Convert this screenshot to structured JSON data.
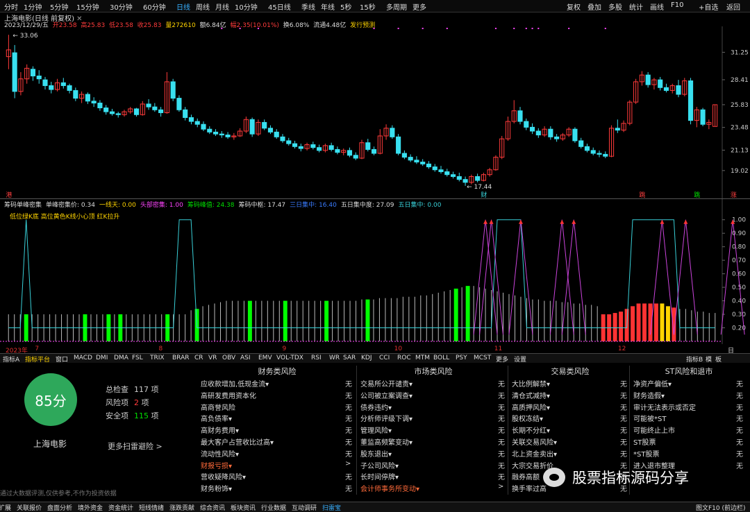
{
  "timeframes": [
    "分时",
    "1分钟",
    "5分钟",
    "15分钟",
    "30分钟",
    "60分钟",
    "日线",
    "周线",
    "月线",
    "10分钟",
    "45日线",
    "季线",
    "年线",
    "5秒",
    "15秒",
    "多周期",
    "更多"
  ],
  "active_timeframe": "日线",
  "toolbar_right": [
    "复权",
    "叠加",
    "多股",
    "统计",
    "画线",
    "F10",
    "+自选",
    "返回"
  ],
  "chart_title": "上海电影(日线 前复权)",
  "ohlc": {
    "date": "2023/12/29/五",
    "open": "开23.58",
    "high": "高25.83",
    "low": "低23.58",
    "close": "收25.83",
    "vol": "量272610",
    "amount": "额6.84亿",
    "pct": "幅2.35(10.01%)",
    "turnover": "换6.08%",
    "float": "流通4.48亿",
    "brand": "发行预测"
  },
  "price_max_label": "33.06",
  "price_min_label": "17.44",
  "price_axis": [
    "31.25",
    "28.41",
    "25.83",
    "23.48",
    "21.13",
    "19.02"
  ],
  "price_axis_range": [
    17,
    33.5
  ],
  "candles": [
    [
      30.8,
      33.06,
      29.5,
      31.5
    ],
    [
      31.2,
      32.0,
      26.5,
      27.2
    ],
    [
      27.2,
      29.2,
      26.8,
      28.5
    ],
    [
      28.5,
      30.0,
      28.0,
      29.6
    ],
    [
      29.5,
      29.8,
      28.3,
      28.8
    ],
    [
      28.8,
      29.4,
      28.0,
      28.5
    ],
    [
      28.4,
      28.7,
      27.4,
      27.8
    ],
    [
      27.8,
      28.2,
      27.0,
      27.4
    ],
    [
      27.4,
      28.5,
      27.2,
      28.1
    ],
    [
      28.1,
      28.6,
      27.5,
      27.8
    ],
    [
      27.8,
      28.0,
      27.0,
      27.3
    ],
    [
      27.3,
      27.6,
      26.2,
      26.5
    ],
    [
      26.5,
      27.2,
      26.0,
      26.9
    ],
    [
      26.9,
      27.1,
      25.9,
      26.2
    ],
    [
      26.2,
      26.6,
      25.6,
      26.0
    ],
    [
      26.0,
      26.3,
      25.2,
      25.5
    ],
    [
      25.5,
      25.8,
      24.8,
      25.1
    ],
    [
      25.1,
      25.4,
      24.7,
      24.9
    ],
    [
      24.9,
      25.1,
      24.5,
      24.8
    ],
    [
      24.8,
      25.3,
      24.6,
      25.1
    ],
    [
      25.1,
      25.6,
      24.9,
      25.4
    ],
    [
      25.4,
      25.5,
      24.6,
      24.8
    ],
    [
      24.8,
      26.2,
      24.7,
      25.9
    ],
    [
      25.9,
      26.4,
      25.3,
      25.6
    ],
    [
      25.6,
      26.0,
      25.1,
      25.3
    ],
    [
      25.3,
      25.6,
      24.6,
      25.0
    ],
    [
      25.0,
      29.2,
      24.9,
      28.2
    ],
    [
      28.2,
      28.5,
      26.2,
      26.5
    ],
    [
      26.5,
      26.8,
      25.1,
      25.3
    ],
    [
      25.3,
      25.6,
      24.2,
      24.5
    ],
    [
      24.5,
      24.8,
      23.8,
      24.1
    ],
    [
      24.1,
      24.4,
      23.5,
      23.8
    ],
    [
      23.8,
      24.1,
      23.1,
      23.3
    ],
    [
      23.3,
      23.6,
      22.8,
      23.0
    ],
    [
      23.0,
      23.3,
      22.6,
      22.8
    ],
    [
      22.8,
      23.1,
      22.4,
      22.7
    ],
    [
      22.7,
      23.0,
      22.3,
      22.5
    ],
    [
      22.5,
      22.9,
      22.2,
      22.6
    ],
    [
      22.6,
      23.4,
      22.5,
      23.1
    ],
    [
      23.1,
      24.6,
      22.9,
      24.3
    ],
    [
      24.3,
      24.5,
      22.5,
      22.8
    ],
    [
      22.8,
      24.3,
      22.6,
      24.0
    ],
    [
      24.0,
      24.3,
      23.2,
      23.4
    ],
    [
      23.4,
      23.7,
      22.8,
      23.0
    ],
    [
      23.0,
      23.3,
      22.3,
      22.5
    ],
    [
      22.5,
      22.8,
      21.9,
      22.1
    ],
    [
      22.1,
      22.4,
      21.6,
      21.8
    ],
    [
      21.8,
      22.1,
      21.3,
      21.5
    ],
    [
      21.5,
      21.8,
      21.0,
      21.3
    ],
    [
      21.3,
      21.9,
      21.1,
      21.7
    ],
    [
      21.7,
      22.0,
      21.2,
      21.4
    ],
    [
      21.4,
      21.7,
      20.9,
      21.1
    ],
    [
      21.1,
      21.8,
      20.9,
      21.6
    ],
    [
      21.6,
      21.9,
      21.0,
      21.2
    ],
    [
      21.2,
      21.5,
      20.7,
      20.9
    ],
    [
      20.9,
      21.3,
      20.6,
      21.1
    ],
    [
      21.1,
      21.4,
      20.4,
      20.6
    ],
    [
      20.6,
      20.9,
      20.1,
      20.3
    ],
    [
      20.3,
      22.2,
      20.2,
      21.9
    ],
    [
      21.9,
      22.3,
      21.0,
      21.2
    ],
    [
      21.2,
      21.5,
      20.6,
      20.8
    ],
    [
      20.8,
      23.3,
      20.7,
      22.6
    ],
    [
      22.6,
      23.8,
      22.2,
      23.4
    ],
    [
      23.4,
      23.7,
      22.3,
      22.5
    ],
    [
      22.5,
      22.8,
      20.6,
      20.8
    ],
    [
      20.8,
      21.1,
      20.2,
      20.4
    ],
    [
      20.4,
      20.7,
      19.9,
      20.1
    ],
    [
      20.1,
      20.5,
      19.7,
      19.9
    ],
    [
      19.9,
      20.2,
      19.5,
      19.7
    ],
    [
      19.7,
      20.0,
      19.2,
      19.4
    ],
    [
      19.4,
      19.7,
      18.9,
      19.1
    ],
    [
      19.1,
      19.5,
      18.7,
      18.9
    ],
    [
      18.9,
      19.2,
      18.4,
      18.6
    ],
    [
      18.6,
      18.9,
      18.2,
      18.4
    ],
    [
      18.4,
      18.8,
      17.9,
      18.1
    ],
    [
      18.1,
      18.4,
      17.44,
      17.8
    ],
    [
      17.8,
      18.6,
      17.6,
      18.4
    ],
    [
      18.4,
      18.7,
      17.8,
      18.0
    ],
    [
      18.0,
      18.8,
      17.9,
      18.6
    ],
    [
      18.6,
      19.3,
      18.4,
      19.1
    ],
    [
      19.1,
      20.6,
      19.0,
      20.4
    ],
    [
      20.4,
      22.6,
      20.2,
      22.3
    ],
    [
      22.3,
      24.6,
      22.1,
      24.1
    ],
    [
      24.1,
      26.3,
      23.9,
      25.2
    ],
    [
      25.2,
      25.6,
      23.8,
      24.1
    ],
    [
      24.1,
      24.4,
      23.2,
      23.5
    ],
    [
      23.5,
      23.9,
      22.8,
      23.1
    ],
    [
      23.1,
      23.4,
      22.4,
      22.7
    ],
    [
      22.7,
      23.6,
      22.5,
      23.3
    ],
    [
      23.3,
      23.6,
      22.2,
      22.5
    ],
    [
      22.5,
      22.8,
      22.0,
      22.3
    ],
    [
      22.3,
      22.9,
      22.1,
      22.7
    ],
    [
      22.7,
      23.5,
      22.5,
      23.3
    ],
    [
      23.3,
      23.5,
      21.9,
      22.1
    ],
    [
      22.1,
      22.4,
      21.3,
      21.5
    ],
    [
      21.5,
      21.8,
      20.9,
      21.1
    ],
    [
      21.1,
      21.4,
      20.6,
      20.8
    ],
    [
      20.8,
      21.1,
      20.4,
      20.7
    ],
    [
      20.7,
      21.0,
      20.3,
      20.5
    ],
    [
      20.5,
      23.7,
      20.4,
      23.4
    ],
    [
      23.4,
      24.3,
      22.9,
      23.2
    ],
    [
      23.2,
      24.2,
      23.0,
      23.9
    ],
    [
      23.9,
      26.3,
      23.7,
      26.1
    ],
    [
      26.1,
      28.5,
      25.9,
      28.2
    ],
    [
      28.2,
      29.3,
      27.8,
      28.9
    ],
    [
      28.9,
      29.2,
      27.6,
      27.9
    ],
    [
      27.9,
      28.6,
      27.4,
      28.4
    ],
    [
      28.4,
      28.7,
      27.3,
      27.6
    ],
    [
      27.6,
      28.0,
      27.1,
      27.3
    ],
    [
      27.3,
      28.0,
      27.0,
      27.8
    ],
    [
      27.8,
      28.4,
      26.6,
      26.9
    ],
    [
      26.9,
      28.6,
      26.7,
      28.3
    ],
    [
      28.3,
      28.6,
      23.8,
      24.2
    ],
    [
      24.2,
      25.6,
      23.5,
      25.3
    ],
    [
      25.3,
      25.5,
      23.6,
      23.8
    ],
    [
      23.8,
      24.3,
      23.3,
      24.0
    ],
    [
      23.58,
      25.83,
      23.58,
      25.83
    ]
  ],
  "price_markers": [
    {
      "label": "港",
      "color": "#ff4040",
      "index": 0
    },
    {
      "label": "财",
      "color": "#39d0d8",
      "index": 78
    },
    {
      "label": "跳",
      "color": "#ff4040",
      "index": 104
    },
    {
      "label": "跳",
      "color": "#00e000",
      "index": 113
    },
    {
      "label": "涨",
      "color": "#ff4040",
      "index": 119
    }
  ],
  "indicator_header": [
    {
      "text": "筹码单峰密集",
      "color": "#dddddd"
    },
    {
      "text": "单峰密集价: 0.34",
      "color": "#dddddd"
    },
    {
      "text": "一线天: 0.00",
      "color": "#ffd400"
    },
    {
      "text": "头部密集: 1.00",
      "color": "#ff44ff"
    },
    {
      "text": "筹码峰值: 24.38",
      "color": "#00e000"
    },
    {
      "text": "筹码中枢: 17.47",
      "color": "#dddddd"
    },
    {
      "text": "三日集中: 16.40",
      "color": "#3a7cff"
    },
    {
      "text": "五日集中度: 27.09",
      "color": "#dddddd"
    },
    {
      "text": "五日集中: 0.00",
      "color": "#39d0d8"
    }
  ],
  "indicator_subtitle": "低位绿K底 高位黄色K线小心顶 红K拉升",
  "indicator_axis": [
    "1.00",
    "0.90",
    "0.80",
    "0.70",
    "0.60",
    "0.50",
    "0.40",
    "0.30",
    "0.20"
  ],
  "indicator_range": [
    0.1,
    1.05
  ],
  "indicator_bar_heights": [
    0.3,
    0.3,
    0.3,
    0.3,
    0.3,
    0.3,
    0.3,
    0.3,
    0.3,
    0.3,
    0.3,
    0.3,
    0.3,
    0.3,
    0.3,
    0.3,
    0.3,
    0.3,
    0.3,
    0.3,
    0.3,
    0.3,
    0.3,
    0.3,
    0.3,
    0.3,
    0.3,
    0.3,
    0.3,
    0.3,
    0.3,
    0.33,
    0.34,
    0.36,
    0.37,
    0.38,
    0.39,
    0.4,
    0.4,
    0.4,
    0.4,
    0.4,
    0.4,
    0.4,
    0.4,
    0.4,
    0.4,
    0.4,
    0.4,
    0.4,
    0.4,
    0.4,
    0.4,
    0.4,
    0.4,
    0.4,
    0.4,
    0.4,
    0.4,
    0.4,
    0.41,
    0.41,
    0.41,
    0.42,
    0.42,
    0.42,
    0.42,
    0.43,
    0.43,
    0.43,
    0.44,
    0.44,
    0.45,
    0.46,
    0.47,
    0.48,
    0.49,
    0.5,
    0.51,
    0.51,
    0.5,
    0.49,
    0.48,
    0.47,
    0.46,
    0.45,
    0.44,
    0.43,
    0.42,
    0.41,
    0.41,
    0.4,
    0.4,
    0.4,
    0.39,
    0.39,
    0.38,
    0.38,
    0.37,
    0.37,
    0.36,
    0.3,
    0.3,
    0.31,
    0.32,
    0.34,
    0.36,
    0.38,
    0.38,
    0.38,
    0.38,
    0.38,
    0.36,
    0.35,
    0.34,
    0.34,
    0.33,
    0.32,
    0.32,
    0.31,
    0.31
  ],
  "indicator_bar_colors": {
    "3": "#00ff00",
    "13": "#00ff00",
    "17": "#00ff00",
    "19": "#00ff00",
    "27": "#00ff00",
    "32": "#00ff00",
    "41": "#00ff00",
    "47": "#00ff00",
    "54": "#00ff00",
    "61": "#00ff00",
    "76": "#00ff00",
    "78": "#00ff00",
    "101": "#ff3333",
    "102": "#ff3333",
    "103": "#ff3333",
    "104": "#ff3333",
    "105": "#ff3333",
    "106": "#ff3333",
    "107": "#ff3333",
    "108": "#ff3333",
    "109": "#ff3333",
    "110": "#ff3333",
    "111": "#ffd400",
    "112": "#ffd400",
    "113": "#ff3333"
  },
  "cyan_line": [
    0.2,
    0.2,
    0.2,
    1.0,
    0.2,
    0.2,
    0.2,
    0.2,
    0.2,
    0.2,
    0.2,
    0.2,
    0.2,
    0.2,
    0.2,
    0.2,
    0.2,
    0.2,
    0.2,
    0.2,
    0.2,
    0.2,
    0.2,
    0.2,
    0.2,
    0.2,
    0.2,
    0.2,
    0.2,
    1.0,
    1.0,
    1.0,
    0.2,
    0.2,
    0.2,
    0.2,
    0.2,
    0.2,
    0.2,
    0.2,
    0.2,
    0.2,
    0.2,
    0.2,
    0.2,
    0.2,
    0.2,
    0.2,
    0.2,
    0.2,
    0.2,
    0.2,
    0.2,
    0.2,
    0.2,
    0.2,
    0.2,
    0.2,
    0.2,
    0.2,
    0.2,
    0.2,
    0.2,
    0.2,
    0.2,
    0.2,
    0.2,
    0.2,
    0.2,
    0.2,
    0.2,
    0.2,
    0.2,
    0.2,
    0.2,
    0.2,
    0.2,
    0.2,
    0.2,
    0.2,
    0.2,
    0.2,
    0.2,
    1.0,
    1.0,
    1.0,
    1.0,
    1.0,
    0.2,
    0.2,
    0.2,
    0.2,
    0.2,
    0.2,
    0.2,
    0.2,
    0.2,
    0.2,
    0.2,
    0.2,
    0.2,
    0.2,
    0.2,
    0.2,
    0.2,
    0.2,
    1.0,
    1.0,
    1.0,
    1.0,
    1.0,
    1.0,
    1.0,
    1.0,
    0.2,
    0.2,
    0.2,
    0.2,
    0.2,
    0.2,
    0.2
  ],
  "magenta_peaks": [
    81,
    82,
    87,
    94,
    96,
    111,
    115,
    123
  ],
  "date_labels": [
    {
      "label": "2023年",
      "index": 0
    },
    {
      "label": "7",
      "index": 5
    },
    {
      "label": "8",
      "index": 26
    },
    {
      "label": "9",
      "index": 47
    },
    {
      "label": "10",
      "index": 66
    },
    {
      "label": "11",
      "index": 83
    },
    {
      "label": "12",
      "index": 104
    }
  ],
  "date_right": "日线",
  "indicator_tabs": [
    "指标A",
    "指标平台",
    "窗口",
    "MACD",
    "DMI",
    "DMA",
    "FSL",
    "TRIX",
    "BRAR",
    "CR",
    "VR",
    "OBV",
    "ASI",
    "EMV",
    "VOL-TDX",
    "RSI",
    "WR",
    "SAR",
    "KDJ",
    "CCI",
    "ROC",
    "MTM",
    "BOLL",
    "PSY",
    "MCST",
    "更多",
    "设置"
  ],
  "indicator_tabs_right": [
    "指标B",
    "模",
    "板"
  ],
  "active_indicator_tab": "指标平台",
  "score": "85分",
  "stock_name": "上海电影",
  "stats": {
    "total_label": "总检查",
    "total_value": "117",
    "total_unit": "项",
    "risk_label": "风险项",
    "risk_value": "2",
    "risk_unit": "项",
    "safe_label": "安全项",
    "safe_value": "115",
    "safe_unit": "项"
  },
  "more_scan": "更多扫雷避险 >",
  "disclaimer": "通过大数据评测,仅供参考,不作为投资依据",
  "risk_columns": [
    {
      "title": "财务类风险",
      "items": [
        {
          "label": "应收款增加,低现金流▾",
          "value": "无"
        },
        {
          "label": "高研发费用资本化",
          "value": "无"
        },
        {
          "label": "高商誉风险",
          "value": "无"
        },
        {
          "label": "高负债率▾",
          "value": "无"
        },
        {
          "label": "高财务费用▾",
          "value": "无"
        },
        {
          "label": "最大客户占营收比过高▾",
          "value": "无"
        },
        {
          "label": "流动性风险▾",
          "value": "无"
        },
        {
          "label": "财报亏损▾",
          "value": ">",
          "hl": true
        },
        {
          "label": "营收疑降风险▾",
          "value": "无"
        },
        {
          "label": "财务粉饰▾",
          "value": "无"
        }
      ]
    },
    {
      "title": "市场类风险",
      "items": [
        {
          "label": "交易所公开谴责▾",
          "value": "无"
        },
        {
          "label": "公司被立案调查▾",
          "value": "无"
        },
        {
          "label": "债券违约▾",
          "value": "无"
        },
        {
          "label": "分析师评级下调▾",
          "value": "无"
        },
        {
          "label": "管理风险▾",
          "value": "无"
        },
        {
          "label": "董监高频繁变动▾",
          "value": "无"
        },
        {
          "label": "股东退出▾",
          "value": "无"
        },
        {
          "label": "子公司风险▾",
          "value": "无"
        },
        {
          "label": "长时间停牌▾",
          "value": "无"
        },
        {
          "label": "会计师事务所变动▾",
          "value": ">",
          "hl": true
        }
      ]
    },
    {
      "title": "交易类风险",
      "items": [
        {
          "label": "大比例解禁▾",
          "value": "无"
        },
        {
          "label": "清仓式减持▾",
          "value": "无"
        },
        {
          "label": "高质押风险▾",
          "value": "无"
        },
        {
          "label": "股权冻结▾",
          "value": "无"
        },
        {
          "label": "长期不分红▾",
          "value": "无"
        },
        {
          "label": "关联交易风险▾",
          "value": "无"
        },
        {
          "label": "北上资金卖出▾",
          "value": "无"
        },
        {
          "label": "大宗交易折价",
          "value": "无"
        },
        {
          "label": "融券高额",
          "value": "无"
        },
        {
          "label": "换手率过高",
          "value": "无"
        }
      ]
    },
    {
      "title": "ST风险和退市",
      "items": [
        {
          "label": "净资产偏低▾",
          "value": "无"
        },
        {
          "label": "财务造假▾",
          "value": "无"
        },
        {
          "label": "审计无法表示或否定",
          "value": "无"
        },
        {
          "label": "可能被*ST",
          "value": "无"
        },
        {
          "label": "可能终止上市",
          "value": "无"
        },
        {
          "label": "ST股票",
          "value": "无"
        },
        {
          "label": "*ST股票",
          "value": "无"
        },
        {
          "label": "进入退市整理",
          "value": "无"
        }
      ]
    }
  ],
  "watermark_text": "股票指标源码分享",
  "status_tabs": [
    "扩展",
    "关联报价",
    "盘面分析",
    "境外资金",
    "资金统计",
    "短线情绪",
    "涨跌贡献",
    "综合资讯",
    "板块资讯",
    "行业数据",
    "互动调研",
    "扫雷宝"
  ],
  "active_status_tab": "扫雷宝",
  "status_right": "图文F10 (前边栏)",
  "colors": {
    "up": "#ff3b3b",
    "down": "#39e0f0",
    "accent": "#38b0ff",
    "score_bg": "#2ea85b"
  }
}
